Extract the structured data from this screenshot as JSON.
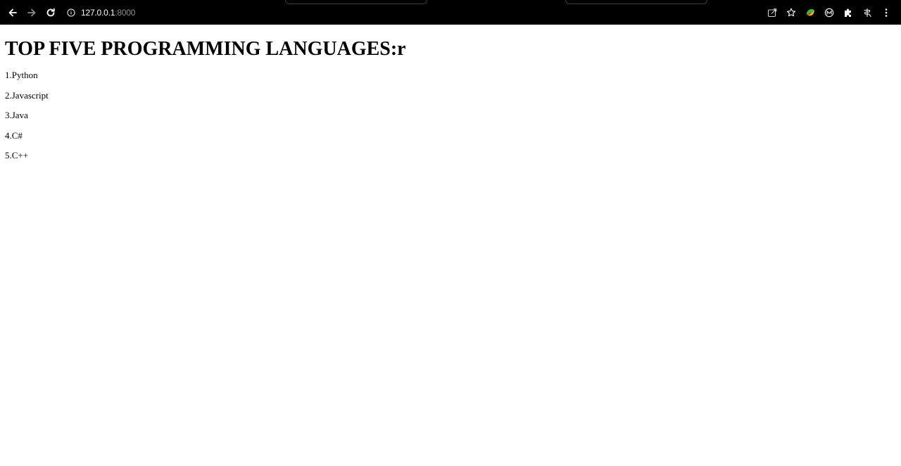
{
  "browser": {
    "url_host": "127.0.0.1",
    "url_port": ":8000",
    "icons": [
      "back-arrow-icon",
      "forward-arrow-icon",
      "reload-icon",
      "info-icon",
      "share-icon",
      "star-icon",
      "extension-color-icon",
      "extension-circle-icon",
      "puzzle-icon",
      "extension-script-icon",
      "kebab-menu-icon"
    ]
  },
  "page": {
    "heading": "TOP FIVE PROGRAMMING LANGUAGES:r",
    "languages": [
      "1.Python",
      "2.Javascript",
      "3.Java",
      "4.C#",
      "5.C++"
    ]
  }
}
